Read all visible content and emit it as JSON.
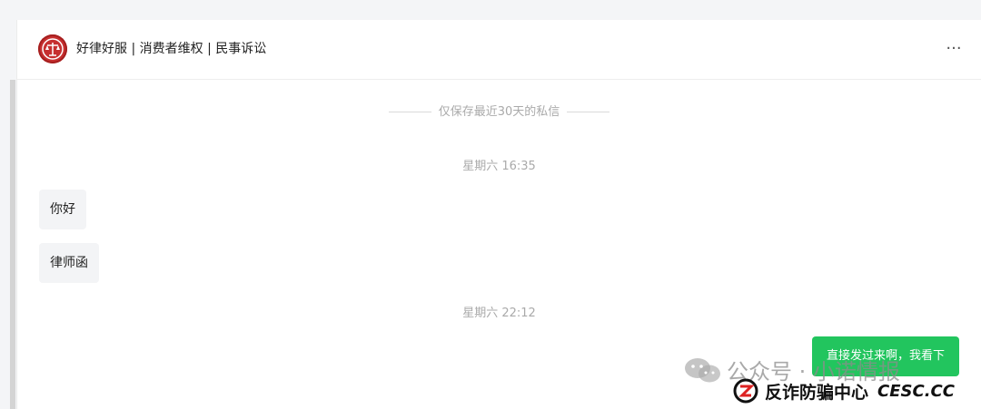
{
  "header": {
    "title": "好律好服 | 消费者维权 | 民事诉讼",
    "more_glyph": "···",
    "avatar_color": "#c62f2f"
  },
  "notice": "仅保存最近30天的私信",
  "messages": [
    {
      "type": "timestamp",
      "text": "星期六 16:35"
    },
    {
      "type": "incoming",
      "text": "你好"
    },
    {
      "type": "incoming",
      "text": "律师函"
    },
    {
      "type": "timestamp",
      "text": "星期六 22:12"
    },
    {
      "type": "outgoing",
      "text": "直接发过来啊，我看下"
    }
  ],
  "watermark": {
    "account": "公众号 · 小诺情报",
    "center": "反诈防骗中心",
    "site": "CESC.CC"
  },
  "colors": {
    "outgoing_bubble": "#22c55e",
    "incoming_bubble": "#f3f4f6"
  }
}
